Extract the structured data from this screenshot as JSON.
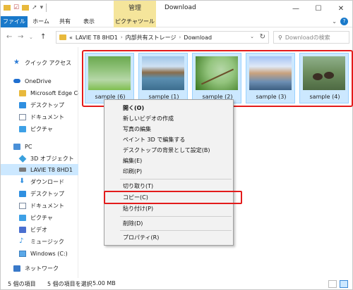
{
  "titlebar": {
    "manage_tab": "管理",
    "title": "Download",
    "qat_icons": [
      "folder-icon",
      "check-icon",
      "folder-icon",
      "pin-icon",
      "dropdown-icon"
    ]
  },
  "ribbon": {
    "tabs": [
      "ファイル",
      "ホーム",
      "共有",
      "表示",
      "ピクチャツール"
    ]
  },
  "address": {
    "prefix": "«",
    "crumbs": [
      "LAVIE T8 8HD1",
      "内部共有ストレージ",
      "Download"
    ],
    "search_placeholder": "Downloadの検索"
  },
  "sidebar": {
    "items": [
      {
        "label": "クイック アクセス",
        "icon": "star-icon"
      },
      {
        "label": "OneDrive",
        "icon": "cloud-icon"
      },
      {
        "label": "Microsoft Edge Co",
        "icon": "folder-icon"
      },
      {
        "label": "デスクトップ",
        "icon": "desktop-icon"
      },
      {
        "label": "ドキュメント",
        "icon": "document-icon"
      },
      {
        "label": "ピクチャ",
        "icon": "picture-icon"
      },
      {
        "label": "PC",
        "icon": "pc-icon"
      },
      {
        "label": "3D オブジェクト",
        "icon": "cube-icon"
      },
      {
        "label": "LAVIE T8 8HD1",
        "icon": "device-icon"
      },
      {
        "label": "ダウンロード",
        "icon": "download-icon"
      },
      {
        "label": "デスクトップ",
        "icon": "desktop-icon"
      },
      {
        "label": "ドキュメント",
        "icon": "document-icon"
      },
      {
        "label": "ピクチャ",
        "icon": "picture-icon"
      },
      {
        "label": "ビデオ",
        "icon": "video-icon"
      },
      {
        "label": "ミュージック",
        "icon": "music-icon"
      },
      {
        "label": "Windows (C:)",
        "icon": "drive-icon"
      },
      {
        "label": "ネットワーク",
        "icon": "network-icon"
      }
    ]
  },
  "files": [
    {
      "name": "sample (6)"
    },
    {
      "name": "sample (1)"
    },
    {
      "name": "sample (2)"
    },
    {
      "name": "sample (3)"
    },
    {
      "name": "sample (4)"
    }
  ],
  "context_menu": {
    "items": [
      "開く(O)",
      "新しいビデオの作成",
      "写真の編集",
      "ペイント 3D で編集する",
      "デスクトップの背景として設定(B)",
      "編集(E)",
      "印刷(P)",
      "切り取り(T)",
      "コピー(C)",
      "貼り付け(P)",
      "削除(D)",
      "プロパティ(R)"
    ],
    "highlighted": "コピー(C)"
  },
  "status": {
    "item_count": "5 個の項目",
    "selection": "5 個の項目を選択",
    "size": "5.00 MB"
  },
  "colors": {
    "accent": "#1979ca",
    "highlight_box": "#e31b1b",
    "selection_fill": "#cce8ff",
    "picture_tools_tab": "#f5e59b"
  }
}
